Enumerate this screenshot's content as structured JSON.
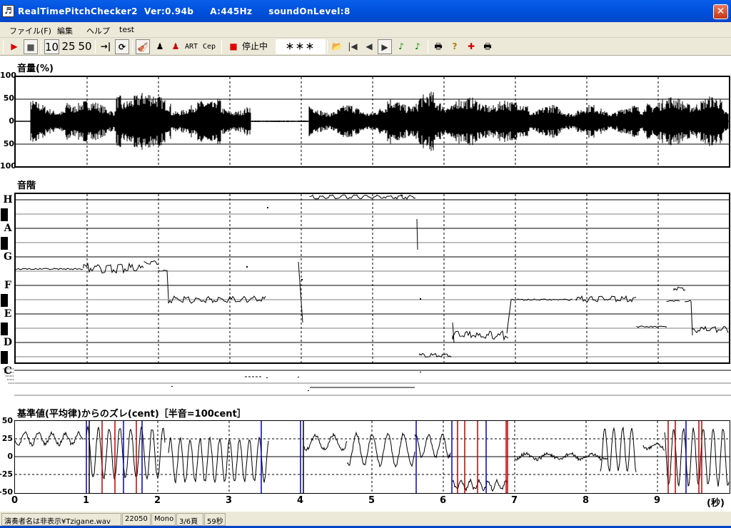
{
  "window": {
    "title": "RealTimePitchChecker2  Ver:0.94b     A:445Hz     soundOnLevel:8",
    "close_label": "✕",
    "app_icon": "violin-icon"
  },
  "menu": {
    "items": [
      "ファイル(F)",
      "編集",
      "ヘルプ",
      "test"
    ]
  },
  "toolbar": {
    "play": "▶",
    "stop": "■",
    "speed_10": "10",
    "speed_25": "25",
    "speed_50": "50",
    "jump": "→|",
    "loop": "⟳",
    "violin": "🎻",
    "person1": "♟",
    "person2": "♟",
    "art": "ART",
    "cep": "Cep",
    "rec": "■",
    "status": "停止中",
    "note_display": "＊＊＊",
    "open": "📂",
    "first": "|◀",
    "prev": "◀",
    "next": "▶",
    "note1": "♪",
    "note2": "♪",
    "print": "🖶",
    "help": "?",
    "marker": "✚",
    "print2": "🖶",
    "colors": {
      "play": "#e00000",
      "rec": "#e00000",
      "note1": "#008000",
      "note2": "#008000",
      "nav": "#333333"
    }
  },
  "volume_panel": {
    "label": "音量(%)",
    "yticks": [
      "100",
      "50",
      "0",
      "50",
      "100"
    ]
  },
  "scale_panel": {
    "label": "音階",
    "notes": [
      "H",
      "A",
      "G",
      "F",
      "E",
      "D",
      "C"
    ]
  },
  "cent_panel": {
    "label": "基準値(平均律)からのズレ(cent)［半音=100cent］",
    "yticks": [
      "50",
      "25",
      "0",
      "-25",
      "-50"
    ]
  },
  "time_axis": {
    "ticks": [
      "0",
      "1",
      "2",
      "3",
      "4",
      "5",
      "6",
      "7",
      "8",
      "9"
    ],
    "unit": "(秒)"
  },
  "statusbar": {
    "performer": "演奏者名は非表示¥Tzigane.wav",
    "rate": "22050",
    "channels": "Mono",
    "page": "3/6頁",
    "duration": "59秒"
  }
}
